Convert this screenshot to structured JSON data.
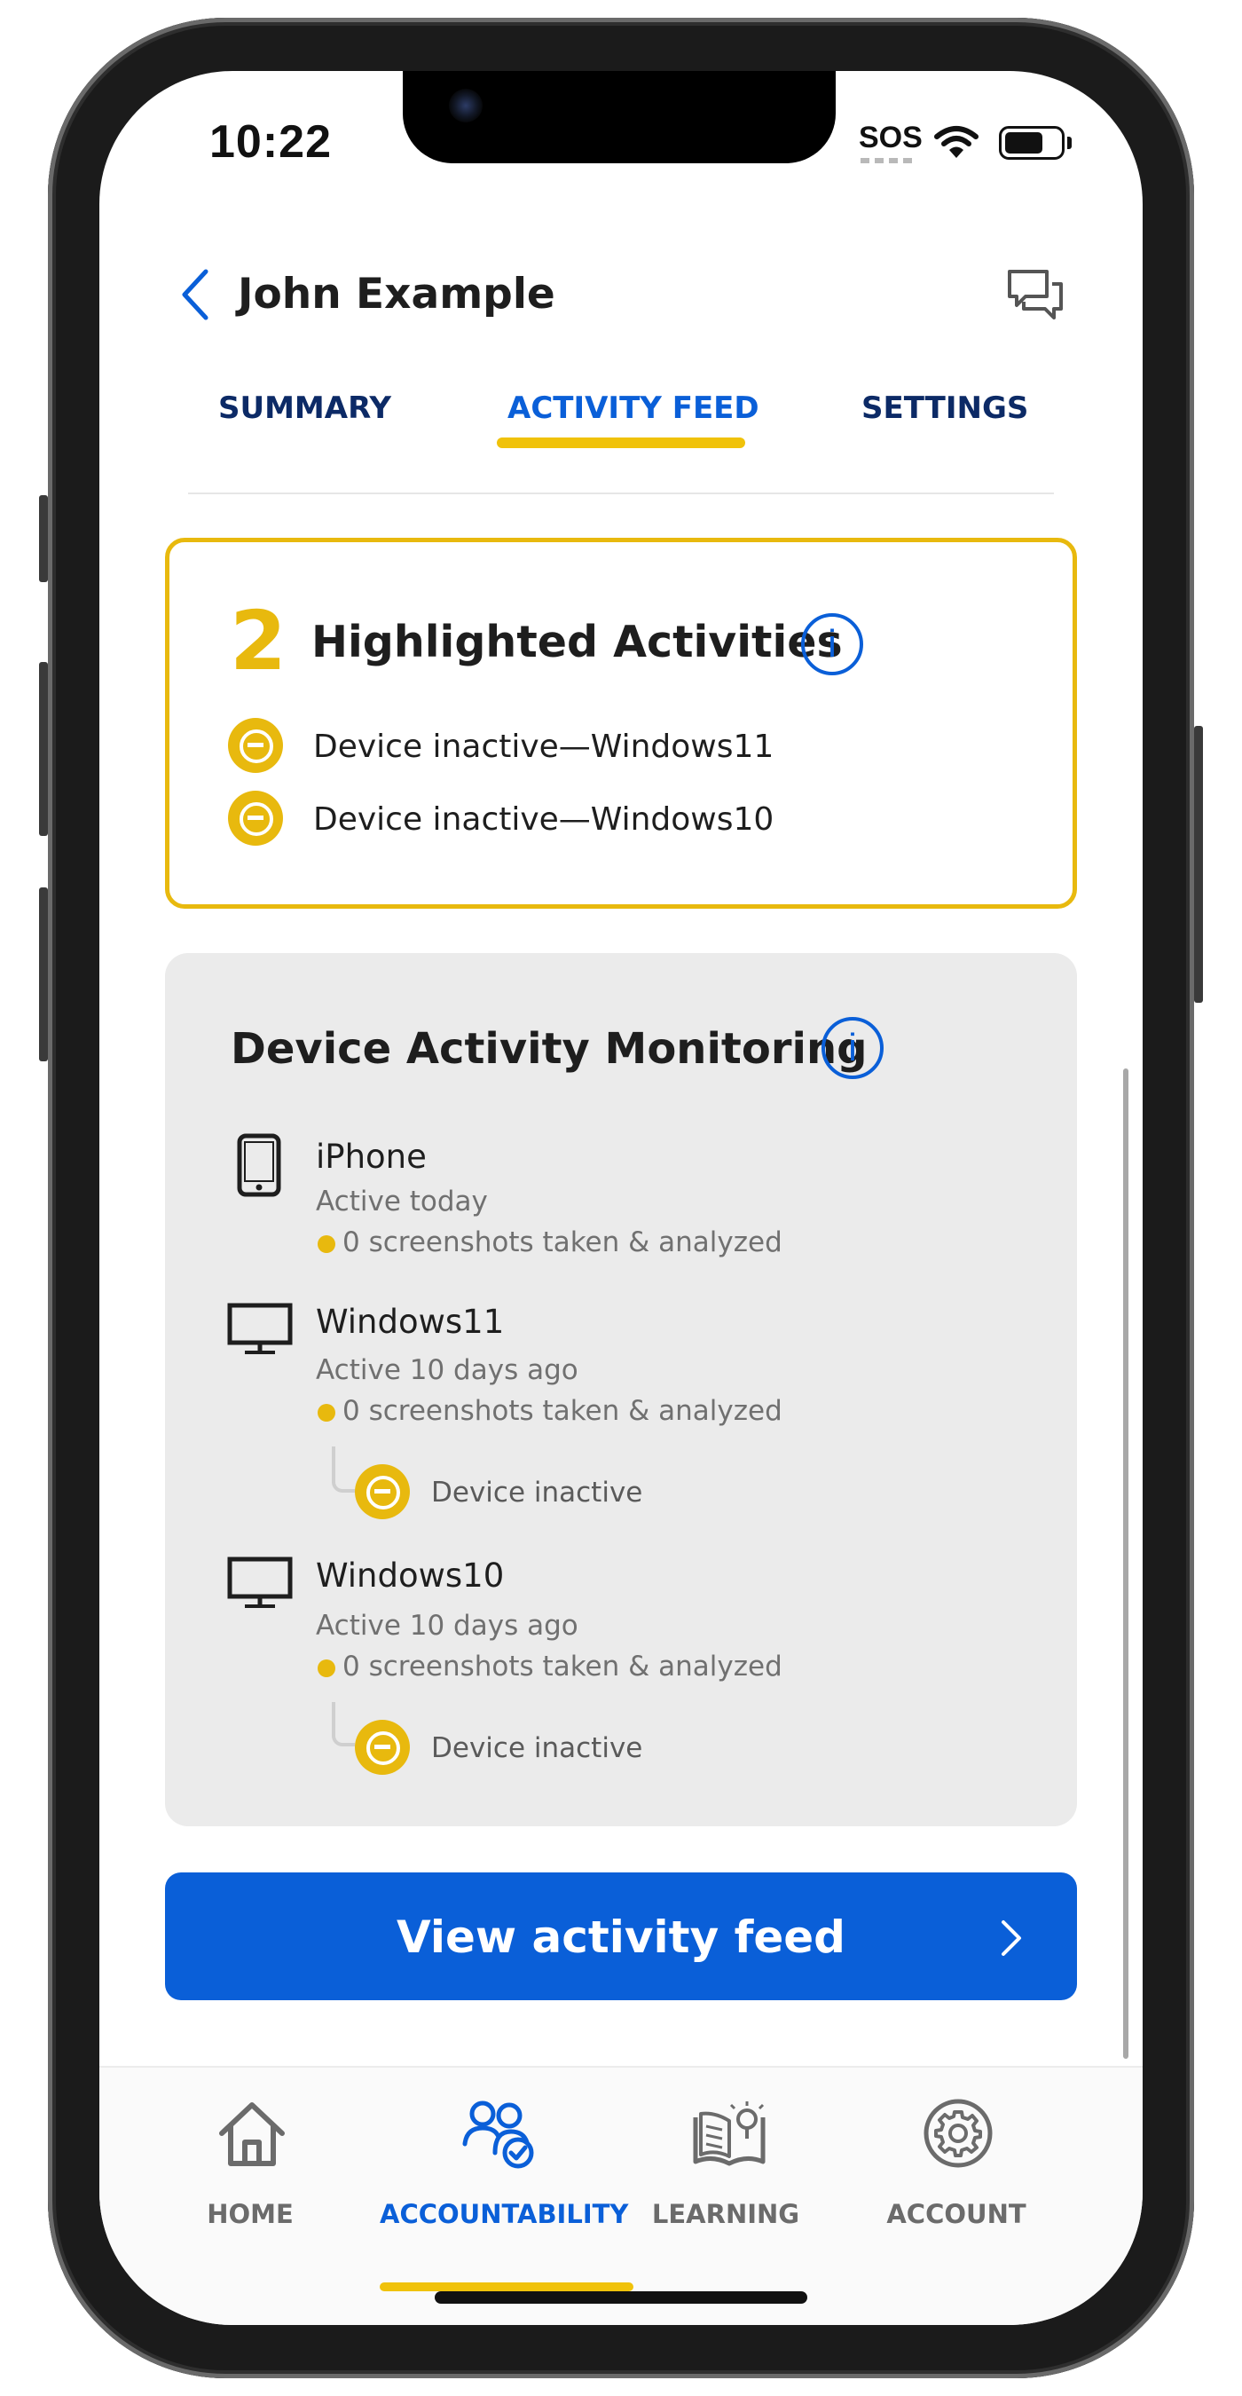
{
  "status_bar": {
    "time": "10:22",
    "sos": "SOS"
  },
  "header": {
    "title": "John Example"
  },
  "tabs": [
    {
      "label": "SUMMARY",
      "active": false
    },
    {
      "label": "ACTIVITY FEED",
      "active": true
    },
    {
      "label": "SETTINGS",
      "active": false
    }
  ],
  "highlights": {
    "count": "2",
    "title": "Highlighted Activities",
    "info_icon": "i",
    "items": [
      {
        "text": "Device inactive—Windows11"
      },
      {
        "text": "Device inactive—Windows10"
      }
    ]
  },
  "monitoring": {
    "title": "Device Activity Monitoring",
    "info_icon": "i",
    "devices": [
      {
        "name": "iPhone",
        "icon": "phone-icon",
        "activity": "Active today",
        "screenshots": "0 screenshots taken & analyzed"
      },
      {
        "name": "Windows11",
        "icon": "monitor-icon",
        "activity": "Active 10 days ago",
        "screenshots": "0 screenshots taken & analyzed",
        "alert": "Device inactive"
      },
      {
        "name": "Windows10",
        "icon": "monitor-icon",
        "activity": "Active 10 days ago",
        "screenshots": "0 screenshots taken & analyzed",
        "alert": "Device inactive"
      }
    ]
  },
  "cta": {
    "label": "View activity feed"
  },
  "bottom_nav": [
    {
      "label": "HOME",
      "icon": "house-icon",
      "active": false
    },
    {
      "label": "ACCOUNTABILITY",
      "icon": "people-check-icon",
      "active": true
    },
    {
      "label": "LEARNING",
      "icon": "book-lightbulb-icon",
      "active": false
    },
    {
      "label": "ACCOUNT",
      "icon": "gear-icon",
      "active": false
    }
  ],
  "colors": {
    "accent_blue": "#0a5fd8",
    "highlight_yellow": "#e8b90e",
    "nav_text": "#0c2a66"
  }
}
